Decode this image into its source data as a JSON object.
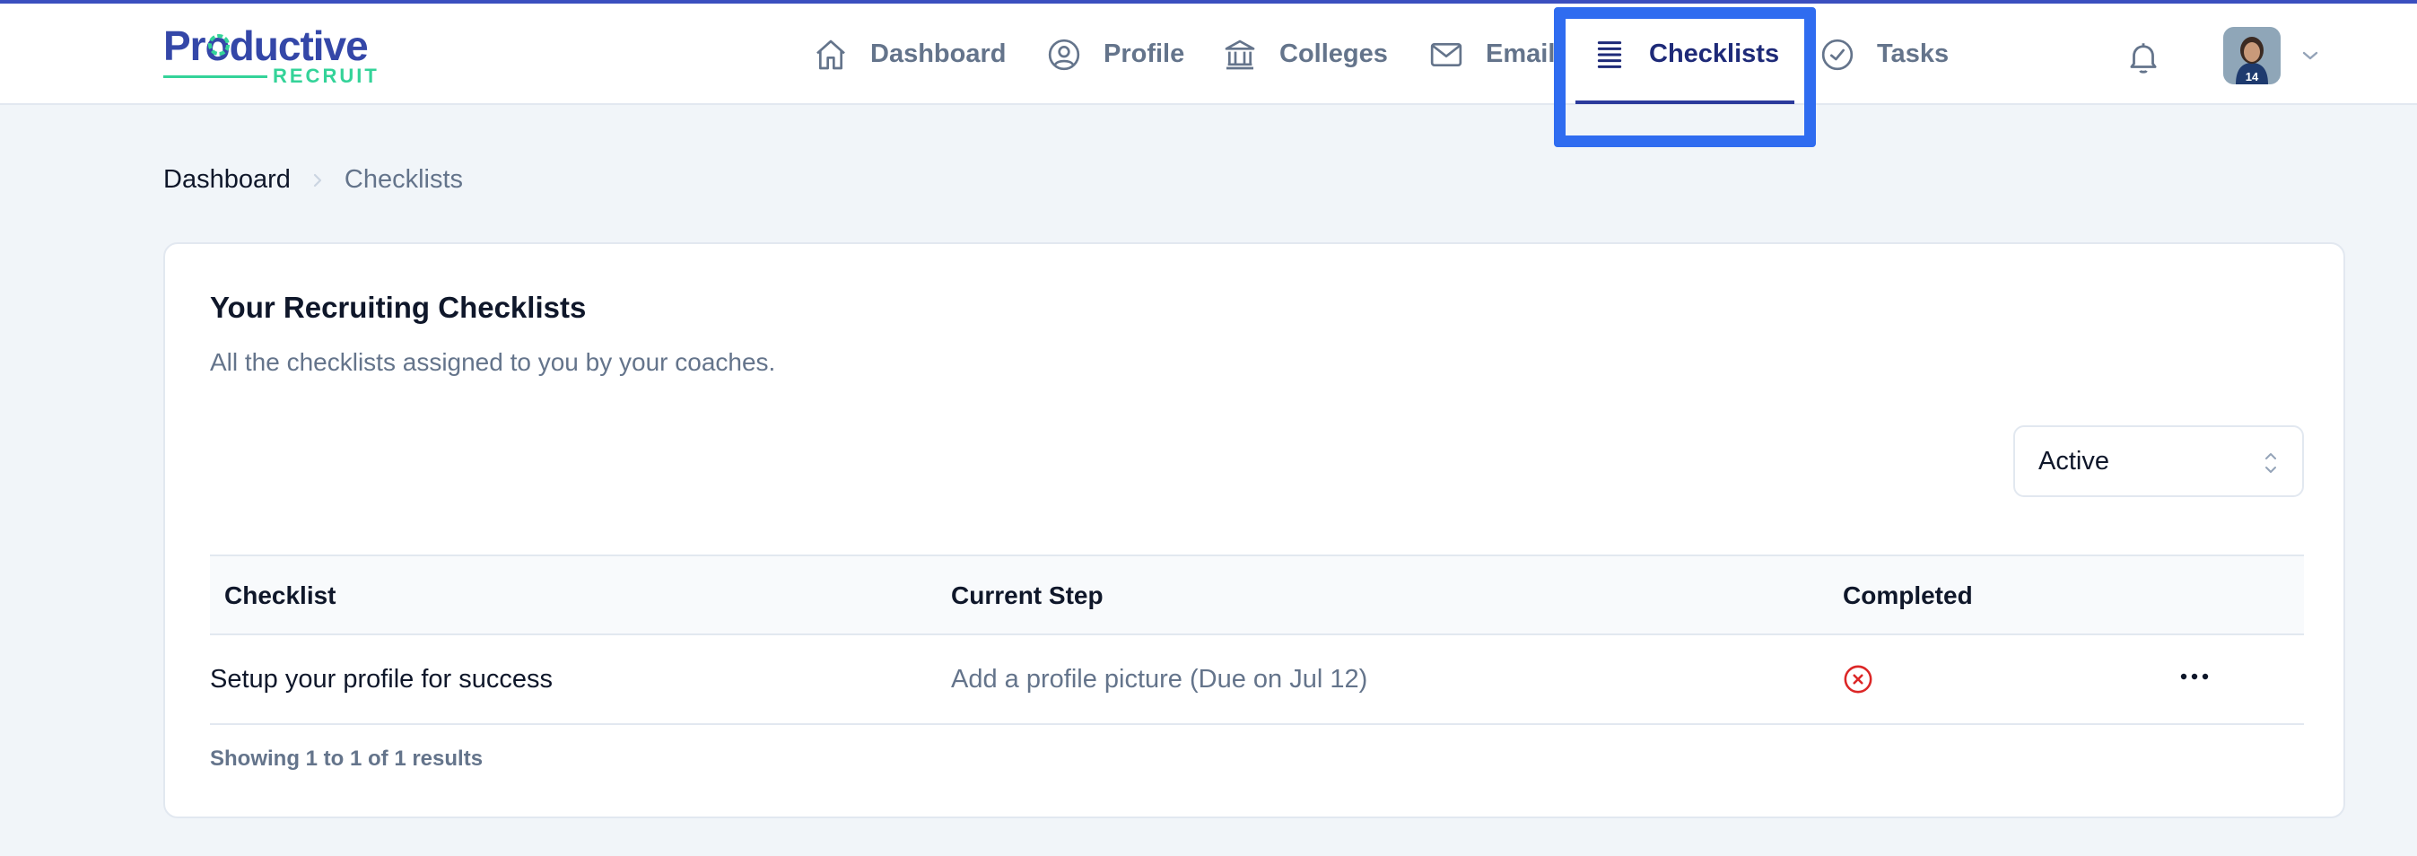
{
  "brand": {
    "name_top": "Productive",
    "name_bottom": "RECRUIT",
    "primary_color": "#3447a8",
    "accent_color": "#34d399"
  },
  "nav": {
    "items": [
      {
        "label": "Dashboard",
        "icon": "home-icon",
        "active": false
      },
      {
        "label": "Profile",
        "icon": "user-circle-icon",
        "active": false
      },
      {
        "label": "Colleges",
        "icon": "building-columns-icon",
        "active": false
      },
      {
        "label": "Email",
        "icon": "envelope-icon",
        "active": false
      },
      {
        "label": "Checklists",
        "icon": "list-lines-icon",
        "active": true
      },
      {
        "label": "Tasks",
        "icon": "check-circle-icon",
        "active": false
      }
    ],
    "notifications_icon": "bell-icon",
    "avatar_jersey": "14"
  },
  "breadcrumb": {
    "home": "Dashboard",
    "current": "Checklists"
  },
  "card": {
    "title": "Your Recruiting Checklists",
    "description": "All the checklists assigned to you by your coaches.",
    "filter": {
      "selected": "Active"
    },
    "table": {
      "columns": [
        "Checklist",
        "Current Step",
        "Completed"
      ],
      "rows": [
        {
          "checklist": "Setup your profile for success",
          "current_step": "Add a profile picture (Due on Jul 12)",
          "completed": false,
          "completed_icon": "x-circle-icon"
        }
      ]
    },
    "results_text": "Showing 1 to 1 of 1 results"
  },
  "highlight_color": "#2f6cf0"
}
